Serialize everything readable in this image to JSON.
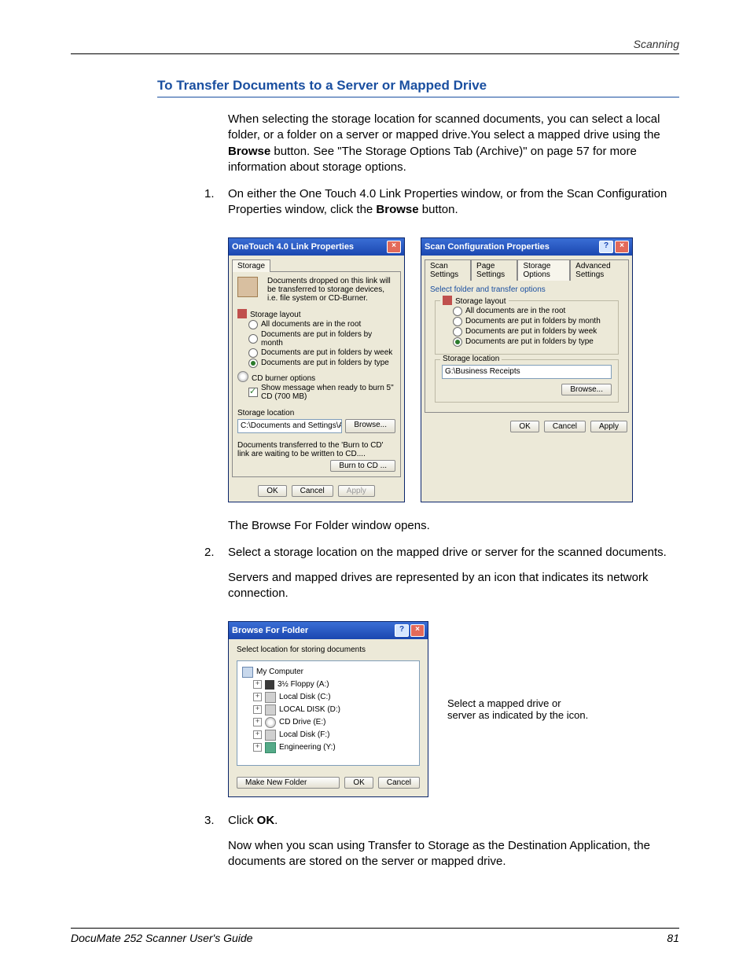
{
  "header": {
    "running": "Scanning"
  },
  "heading": "To Transfer Documents to a Server or Mapped Drive",
  "intro": {
    "p1_a": "When selecting the storage location for scanned documents, you can select a local folder, or a folder on a server or mapped drive.You select a mapped drive using the ",
    "p1_b": "Browse",
    "p1_c": " button. See \"The Storage Options Tab (Archive)\" on page 57 for more information about storage options."
  },
  "steps": {
    "s1_a": "On either the One Touch 4.0 Link Properties window, or from the Scan Configuration Properties window, click the ",
    "s1_b": "Browse",
    "s1_c": " button.",
    "after1": "The Browse For Folder window opens.",
    "s2": "Select a storage location on the mapped drive or server for the scanned documents.",
    "s2_after": "Servers and mapped drives are represented by an icon that indicates its network connection.",
    "s3_a": "Click ",
    "s3_b": "OK",
    "s3_c": ".",
    "s3_after": "Now when you scan using Transfer to Storage as the Destination Application, the documents are stored on the server or mapped drive."
  },
  "linkprops": {
    "title": "OneTouch 4.0 Link Properties",
    "tab": "Storage",
    "desc": "Documents dropped on this link will be transferred to storage devices, i.e. file system or CD-Burner.",
    "layout_legend": "Storage layout",
    "r1": "All documents are in the root",
    "r2": "Documents are put in folders by month",
    "r3": "Documents are put in folders by week",
    "r4": "Documents are put in folders by type",
    "cd_legend": "CD burner options",
    "cd_check": "Show message when ready to burn 5\" CD (700 MB)",
    "loc_label": "Storage location",
    "loc_value": "C:\\Documents and Settings\\Administrator\\My Do",
    "browse": "Browse...",
    "pending": "Documents transferred to the 'Burn to CD' link are waiting to be written to CD....",
    "burn": "Burn to CD ...",
    "ok": "OK",
    "cancel": "Cancel",
    "apply": "Apply"
  },
  "scanconf": {
    "title": "Scan Configuration Properties",
    "tabs": {
      "t1": "Scan Settings",
      "t2": "Page Settings",
      "t3": "Storage Options",
      "t4": "Advanced Settings"
    },
    "select_label": "Select folder and transfer options",
    "layout_legend": "Storage layout",
    "r1": "All documents are in the root",
    "r2": "Documents are put in folders by month",
    "r3": "Documents are put in folders by week",
    "r4": "Documents are put in folders by type",
    "loc_label": "Storage location",
    "loc_value": "G:\\Business Receipts",
    "browse": "Browse...",
    "ok": "OK",
    "cancel": "Cancel",
    "apply": "Apply"
  },
  "browse": {
    "title": "Browse For Folder",
    "subtitle": "Select location for storing documents",
    "nodes": {
      "root": "My Computer",
      "floppy": "3½ Floppy (A:)",
      "c": "Local Disk (C:)",
      "d": "LOCAL DISK (D:)",
      "e": "CD Drive (E:)",
      "f": "Local Disk (F:)",
      "y": "Engineering (Y:)"
    },
    "make": "Make New Folder",
    "ok": "OK",
    "cancel": "Cancel"
  },
  "annotation": "Select a mapped drive or server as indicated by the icon.",
  "footer": {
    "left": "DocuMate 252 Scanner User's Guide",
    "right": "81"
  }
}
